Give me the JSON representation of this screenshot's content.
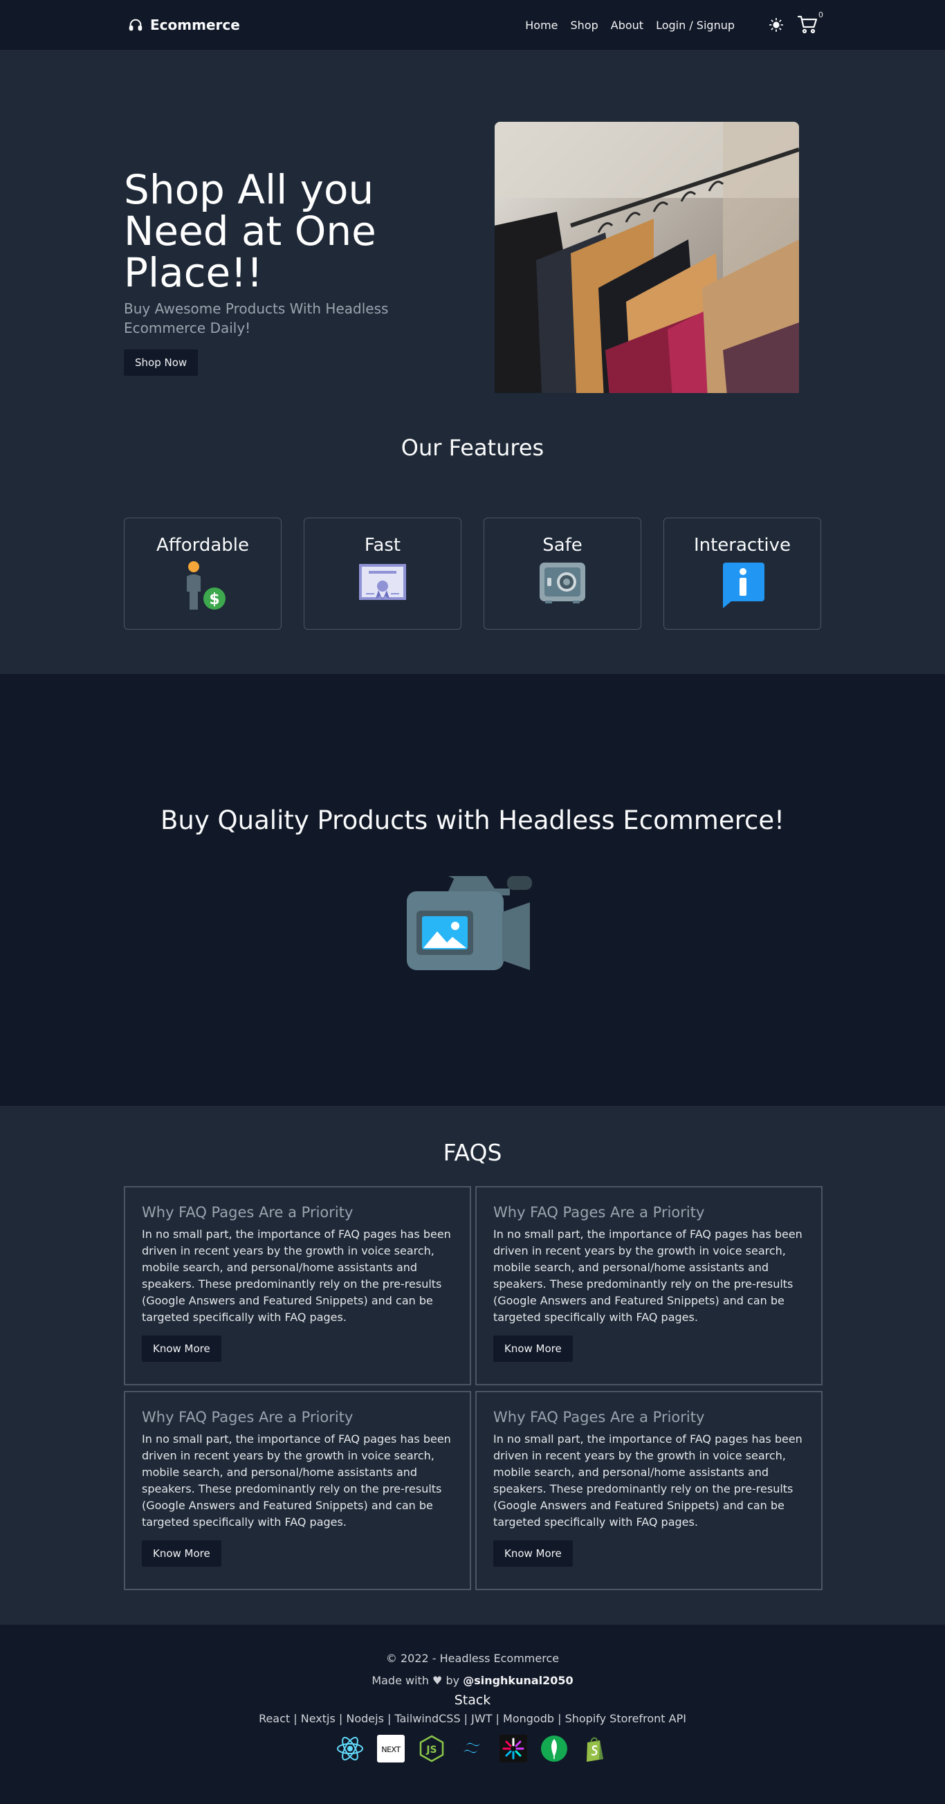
{
  "nav": {
    "brand": "Ecommerce",
    "links": [
      "Home",
      "Shop",
      "About",
      "Login / Signup"
    ],
    "cart_count": "0"
  },
  "hero": {
    "title": "Shop All you Need at One Place!!",
    "subtitle": "Buy Awesome Products With Headless Ecommerce Daily!",
    "cta": "Shop Now"
  },
  "features": {
    "title": "Our Features",
    "items": [
      {
        "label": "Affordable",
        "icon": "person-dollar-icon"
      },
      {
        "label": "Fast",
        "icon": "certificate-icon"
      },
      {
        "label": "Safe",
        "icon": "safe-icon"
      },
      {
        "label": "Interactive",
        "icon": "info-icon"
      }
    ]
  },
  "video": {
    "title": "Buy Quality Products with Headless Ecommerce!",
    "icon": "video-camera-icon"
  },
  "faqs": {
    "title": "FAQS",
    "items": [
      {
        "title": "Why FAQ Pages Are a Priority",
        "body": "In no small part, the importance of FAQ pages has been driven in recent years by the growth in voice search, mobile search, and personal/home assistants and speakers. These predominantly rely on the pre-results (Google Answers and Featured Snippets) and can be targeted specifically with FAQ pages.",
        "cta": "Know More"
      },
      {
        "title": "Why FAQ Pages Are a Priority",
        "body": "In no small part, the importance of FAQ pages has been driven in recent years by the growth in voice search, mobile search, and personal/home assistants and speakers. These predominantly rely on the pre-results (Google Answers and Featured Snippets) and can be targeted specifically with FAQ pages.",
        "cta": "Know More"
      },
      {
        "title": "Why FAQ Pages Are a Priority",
        "body": "In no small part, the importance of FAQ pages has been driven in recent years by the growth in voice search, mobile search, and personal/home assistants and speakers. These predominantly rely on the pre-results (Google Answers and Featured Snippets) and can be targeted specifically with FAQ pages.",
        "cta": "Know More"
      },
      {
        "title": "Why FAQ Pages Are a Priority",
        "body": "In no small part, the importance of FAQ pages has been driven in recent years by the growth in voice search, mobile search, and personal/home assistants and speakers. These predominantly rely on the pre-results (Google Answers and Featured Snippets) and can be targeted specifically with FAQ pages.",
        "cta": "Know More"
      }
    ]
  },
  "footer": {
    "copyright": "© 2022 - Headless Ecommerce",
    "made_with_prefix": "Made with ♥ by",
    "author": "@singhkunal2050",
    "stack_title": "Stack",
    "stack_list": "React | Nextjs | Nodejs | TailwindCSS | JWT | Mongodb | Shopify Storefront API",
    "icons": [
      "react-icon",
      "nextjs-icon",
      "nodejs-icon",
      "tailwind-icon",
      "jwt-icon",
      "mongodb-icon",
      "shopify-icon"
    ],
    "next_logo_text": "NEXT",
    "js_logo_text": "JS"
  },
  "colors": {
    "page_bg": "#1f2937",
    "dark_bg": "#111827",
    "accent_blue": "#2196f3"
  }
}
